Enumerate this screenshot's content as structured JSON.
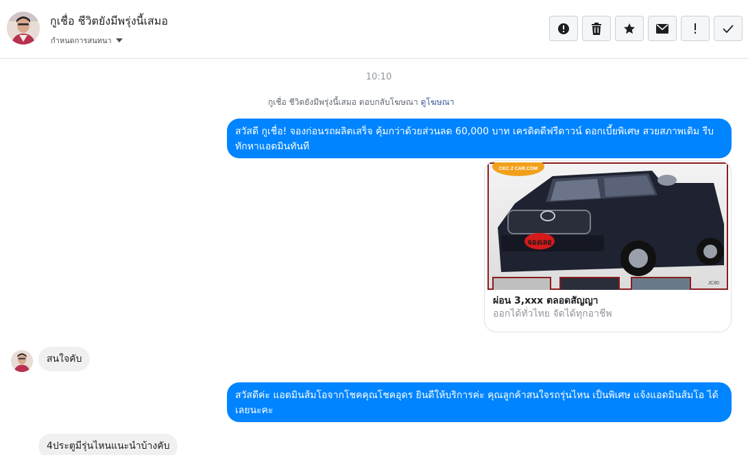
{
  "header": {
    "name": "กูเชื่อ ชีวิตยังมีพรุ่งนี้เสมอ",
    "subtitle": "กำหนดการสนทนา",
    "buttons": [
      {
        "icon": "alert-circle-icon"
      },
      {
        "icon": "trash-icon"
      },
      {
        "icon": "star-icon"
      },
      {
        "icon": "envelope-icon"
      },
      {
        "icon": "exclamation-icon"
      },
      {
        "icon": "checkmark-icon"
      }
    ]
  },
  "conversation": {
    "time": "10:10",
    "ad_note": "กูเชื่อ ชีวิตยังมีพรุ่งนี้เสมอ ตอบกลับโฆษณา",
    "ad_link": "ดูโฆษณา",
    "messages": [
      {
        "from": "page",
        "text": "สวัสดี กูเชื่อ! จองก่อนรถผลิตเสร็จ คุ้มกว่าด้วยส่วนลด 60,000 บาท เครดิตดีฟรีดาวน์ ดอกเบี้ยพิเศษ สวยสภาพเดิม รีบทักหาแอดมินทันที"
      },
      {
        "from": "user",
        "text": "สนใจคับ"
      },
      {
        "from": "page",
        "text": "สวัสดีค่ะ แอดมินส้มโอจากโชคคุณโชคอุดร ยินดีให้บริการค่ะ  คุณลูกค้าสนใจรถรุ่นไหน เป็นพิเศษ แจ้งแอดมินส้มโอ ได้เลยนะคะ"
      },
      {
        "from": "user",
        "text": "4ประตูมีรุ่นไหนแนะนำบ้างคับ"
      }
    ],
    "ad_card": {
      "image_badge": "CKC 2 CAR.COM",
      "image_stamp": "จองเลย",
      "image_plate": "JC80",
      "title": "ผ่อน 3,xxx ตลอดสัญญา",
      "description": "ออกได้ทั่วไทย จัดได้ทุกอาชีพ"
    }
  },
  "colors": {
    "outgoing_bubble": "#0084ff",
    "incoming_bubble": "#f1f0f0",
    "link": "#385898"
  }
}
